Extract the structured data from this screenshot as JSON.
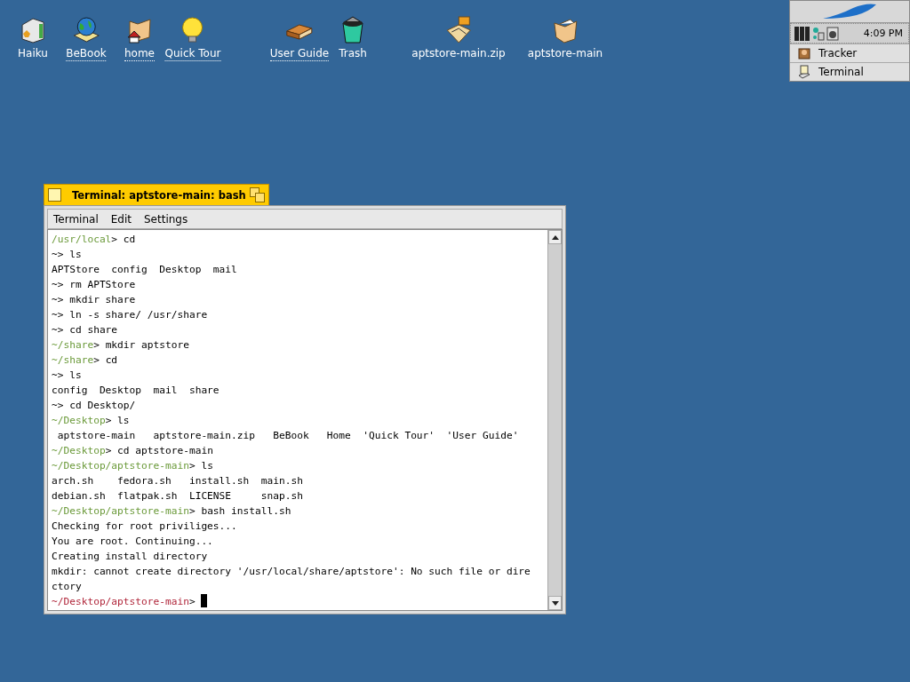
{
  "desktop_icons": [
    {
      "label": "Haiku",
      "kind": "drive",
      "link": false
    },
    {
      "label": "BeBook",
      "kind": "globe",
      "link": true
    },
    {
      "label": "home",
      "kind": "home",
      "link": true
    },
    {
      "label": "Quick Tour",
      "kind": "bulb",
      "link": true
    },
    {
      "label": "User Guide",
      "kind": "book",
      "link": true
    },
    {
      "label": "Trash",
      "kind": "trash",
      "link": false
    },
    {
      "label": "aptstore-main.zip",
      "kind": "zip",
      "link": false
    },
    {
      "label": "aptstore-main",
      "kind": "folder",
      "link": false
    }
  ],
  "deskbar": {
    "clock": "4:09 PM",
    "apps": [
      "Tracker",
      "Terminal"
    ]
  },
  "window": {
    "title": "Terminal: aptstore-main: bash",
    "menu": [
      "Terminal",
      "Edit",
      "Settings"
    ],
    "lines": [
      {
        "kind": "prompt",
        "path": "/usr/local",
        "text": "> cd"
      },
      {
        "kind": "output",
        "text": "~> ls"
      },
      {
        "kind": "output",
        "text": "APTStore  config  Desktop  mail"
      },
      {
        "kind": "output",
        "text": "~> rm APTStore"
      },
      {
        "kind": "output",
        "text": "~> mkdir share"
      },
      {
        "kind": "output",
        "text": "~> ln -s share/ /usr/share"
      },
      {
        "kind": "output",
        "text": "~> cd share"
      },
      {
        "kind": "prompt",
        "path": "~/share",
        "text": "> mkdir aptstore"
      },
      {
        "kind": "prompt",
        "path": "~/share",
        "text": "> cd"
      },
      {
        "kind": "output",
        "text": "~> ls"
      },
      {
        "kind": "output",
        "text": "config  Desktop  mail  share"
      },
      {
        "kind": "output",
        "text": "~> cd Desktop/"
      },
      {
        "kind": "prompt",
        "path": "~/Desktop",
        "text": "> ls"
      },
      {
        "kind": "output",
        "text": " aptstore-main   aptstore-main.zip   BeBook   Home  'Quick Tour'  'User Guide'"
      },
      {
        "kind": "prompt",
        "path": "~/Desktop",
        "text": "> cd aptstore-main"
      },
      {
        "kind": "prompt",
        "path": "~/Desktop/aptstore-main",
        "text": "> ls"
      },
      {
        "kind": "output",
        "text": "arch.sh    fedora.sh   install.sh  main.sh"
      },
      {
        "kind": "output",
        "text": "debian.sh  flatpak.sh  LICENSE     snap.sh"
      },
      {
        "kind": "prompt",
        "path": "~/Desktop/aptstore-main",
        "text": "> bash install.sh"
      },
      {
        "kind": "output",
        "text": "Checking for root priviliges..."
      },
      {
        "kind": "output",
        "text": "You are root. Continuing..."
      },
      {
        "kind": "output",
        "text": "Creating install directory"
      },
      {
        "kind": "output",
        "text": "mkdir: cannot create directory '/usr/local/share/aptstore': No such file or dire"
      },
      {
        "kind": "output",
        "text": "ctory"
      },
      {
        "kind": "current",
        "path": "~/Desktop/aptstore-main",
        "text": "> "
      }
    ]
  }
}
